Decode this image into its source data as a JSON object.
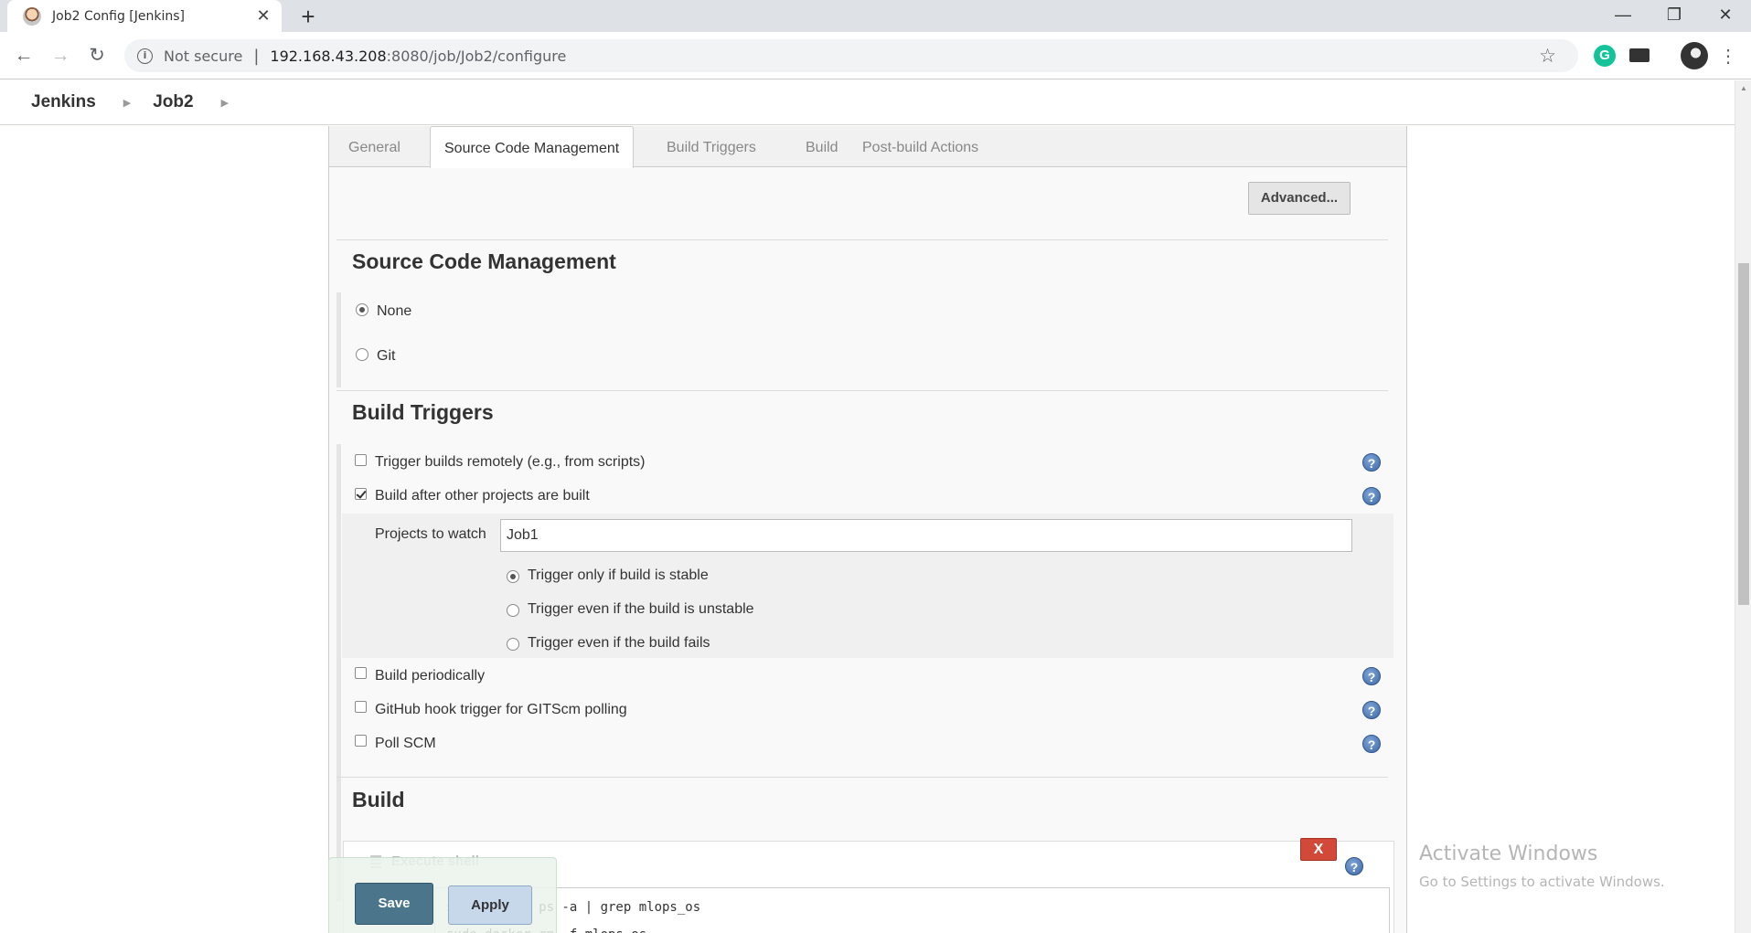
{
  "browser": {
    "tab_title": "Job2 Config [Jenkins]",
    "security_text": "Not secure",
    "url_host": "192.168.43.208",
    "url_path": ":8080/job/Job2/configure",
    "grammarly_letter": "G"
  },
  "breadcrumbs": [
    "Jenkins",
    "Job2"
  ],
  "config_tabs": [
    "General",
    "Source Code Management",
    "Build Triggers",
    "Build",
    "Post-build Actions"
  ],
  "advanced_button": "Advanced...",
  "scm": {
    "title": "Source Code Management",
    "options": [
      {
        "label": "None",
        "selected": true
      },
      {
        "label": "Git",
        "selected": false
      }
    ]
  },
  "build_triggers": {
    "title": "Build Triggers",
    "items": [
      {
        "label": "Trigger builds remotely (e.g., from scripts)",
        "checked": false
      },
      {
        "label": "Build after other projects are built",
        "checked": true
      },
      {
        "label": "Build periodically",
        "checked": false
      },
      {
        "label": "GitHub hook trigger for GITScm polling",
        "checked": false
      },
      {
        "label": "Poll SCM",
        "checked": false
      }
    ],
    "projects_to_watch_label": "Projects to watch",
    "projects_to_watch_value": "Job1",
    "trigger_options": [
      {
        "label": "Trigger only if build is stable",
        "selected": true
      },
      {
        "label": "Trigger even if the build is unstable",
        "selected": false
      },
      {
        "label": "Trigger even if the build fails",
        "selected": false
      }
    ]
  },
  "build": {
    "title": "Build",
    "step_title": "Execute shell",
    "delete_label": "X",
    "shell_lines": [
      "sudo docker ps -a | grep mlops_os",
      "sudo docker rm -f mlops_os"
    ]
  },
  "buttons": {
    "save": "Save",
    "apply": "Apply"
  },
  "help_glyph": "?",
  "watermark": {
    "line1": "Activate Windows",
    "line2": "Go to Settings to activate Windows."
  }
}
